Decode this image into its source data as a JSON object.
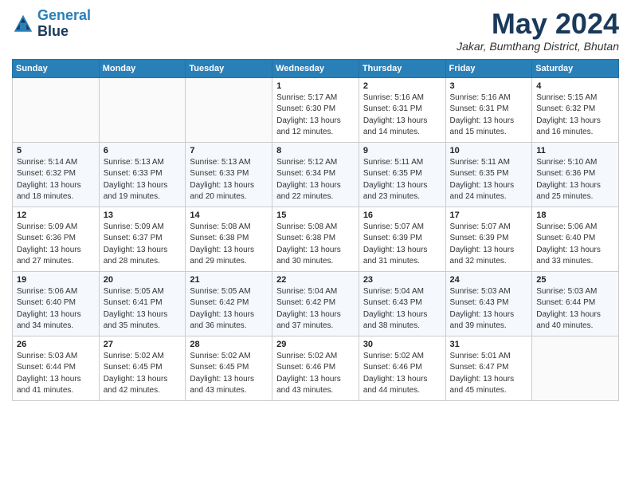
{
  "header": {
    "logo_line1": "General",
    "logo_line2": "Blue",
    "month": "May 2024",
    "location": "Jakar, Bumthang District, Bhutan"
  },
  "weekdays": [
    "Sunday",
    "Monday",
    "Tuesday",
    "Wednesday",
    "Thursday",
    "Friday",
    "Saturday"
  ],
  "weeks": [
    [
      {
        "day": "",
        "info": ""
      },
      {
        "day": "",
        "info": ""
      },
      {
        "day": "",
        "info": ""
      },
      {
        "day": "1",
        "info": "Sunrise: 5:17 AM\nSunset: 6:30 PM\nDaylight: 13 hours\nand 12 minutes."
      },
      {
        "day": "2",
        "info": "Sunrise: 5:16 AM\nSunset: 6:31 PM\nDaylight: 13 hours\nand 14 minutes."
      },
      {
        "day": "3",
        "info": "Sunrise: 5:16 AM\nSunset: 6:31 PM\nDaylight: 13 hours\nand 15 minutes."
      },
      {
        "day": "4",
        "info": "Sunrise: 5:15 AM\nSunset: 6:32 PM\nDaylight: 13 hours\nand 16 minutes."
      }
    ],
    [
      {
        "day": "5",
        "info": "Sunrise: 5:14 AM\nSunset: 6:32 PM\nDaylight: 13 hours\nand 18 minutes."
      },
      {
        "day": "6",
        "info": "Sunrise: 5:13 AM\nSunset: 6:33 PM\nDaylight: 13 hours\nand 19 minutes."
      },
      {
        "day": "7",
        "info": "Sunrise: 5:13 AM\nSunset: 6:33 PM\nDaylight: 13 hours\nand 20 minutes."
      },
      {
        "day": "8",
        "info": "Sunrise: 5:12 AM\nSunset: 6:34 PM\nDaylight: 13 hours\nand 22 minutes."
      },
      {
        "day": "9",
        "info": "Sunrise: 5:11 AM\nSunset: 6:35 PM\nDaylight: 13 hours\nand 23 minutes."
      },
      {
        "day": "10",
        "info": "Sunrise: 5:11 AM\nSunset: 6:35 PM\nDaylight: 13 hours\nand 24 minutes."
      },
      {
        "day": "11",
        "info": "Sunrise: 5:10 AM\nSunset: 6:36 PM\nDaylight: 13 hours\nand 25 minutes."
      }
    ],
    [
      {
        "day": "12",
        "info": "Sunrise: 5:09 AM\nSunset: 6:36 PM\nDaylight: 13 hours\nand 27 minutes."
      },
      {
        "day": "13",
        "info": "Sunrise: 5:09 AM\nSunset: 6:37 PM\nDaylight: 13 hours\nand 28 minutes."
      },
      {
        "day": "14",
        "info": "Sunrise: 5:08 AM\nSunset: 6:38 PM\nDaylight: 13 hours\nand 29 minutes."
      },
      {
        "day": "15",
        "info": "Sunrise: 5:08 AM\nSunset: 6:38 PM\nDaylight: 13 hours\nand 30 minutes."
      },
      {
        "day": "16",
        "info": "Sunrise: 5:07 AM\nSunset: 6:39 PM\nDaylight: 13 hours\nand 31 minutes."
      },
      {
        "day": "17",
        "info": "Sunrise: 5:07 AM\nSunset: 6:39 PM\nDaylight: 13 hours\nand 32 minutes."
      },
      {
        "day": "18",
        "info": "Sunrise: 5:06 AM\nSunset: 6:40 PM\nDaylight: 13 hours\nand 33 minutes."
      }
    ],
    [
      {
        "day": "19",
        "info": "Sunrise: 5:06 AM\nSunset: 6:40 PM\nDaylight: 13 hours\nand 34 minutes."
      },
      {
        "day": "20",
        "info": "Sunrise: 5:05 AM\nSunset: 6:41 PM\nDaylight: 13 hours\nand 35 minutes."
      },
      {
        "day": "21",
        "info": "Sunrise: 5:05 AM\nSunset: 6:42 PM\nDaylight: 13 hours\nand 36 minutes."
      },
      {
        "day": "22",
        "info": "Sunrise: 5:04 AM\nSunset: 6:42 PM\nDaylight: 13 hours\nand 37 minutes."
      },
      {
        "day": "23",
        "info": "Sunrise: 5:04 AM\nSunset: 6:43 PM\nDaylight: 13 hours\nand 38 minutes."
      },
      {
        "day": "24",
        "info": "Sunrise: 5:03 AM\nSunset: 6:43 PM\nDaylight: 13 hours\nand 39 minutes."
      },
      {
        "day": "25",
        "info": "Sunrise: 5:03 AM\nSunset: 6:44 PM\nDaylight: 13 hours\nand 40 minutes."
      }
    ],
    [
      {
        "day": "26",
        "info": "Sunrise: 5:03 AM\nSunset: 6:44 PM\nDaylight: 13 hours\nand 41 minutes."
      },
      {
        "day": "27",
        "info": "Sunrise: 5:02 AM\nSunset: 6:45 PM\nDaylight: 13 hours\nand 42 minutes."
      },
      {
        "day": "28",
        "info": "Sunrise: 5:02 AM\nSunset: 6:45 PM\nDaylight: 13 hours\nand 43 minutes."
      },
      {
        "day": "29",
        "info": "Sunrise: 5:02 AM\nSunset: 6:46 PM\nDaylight: 13 hours\nand 43 minutes."
      },
      {
        "day": "30",
        "info": "Sunrise: 5:02 AM\nSunset: 6:46 PM\nDaylight: 13 hours\nand 44 minutes."
      },
      {
        "day": "31",
        "info": "Sunrise: 5:01 AM\nSunset: 6:47 PM\nDaylight: 13 hours\nand 45 minutes."
      },
      {
        "day": "",
        "info": ""
      }
    ]
  ]
}
